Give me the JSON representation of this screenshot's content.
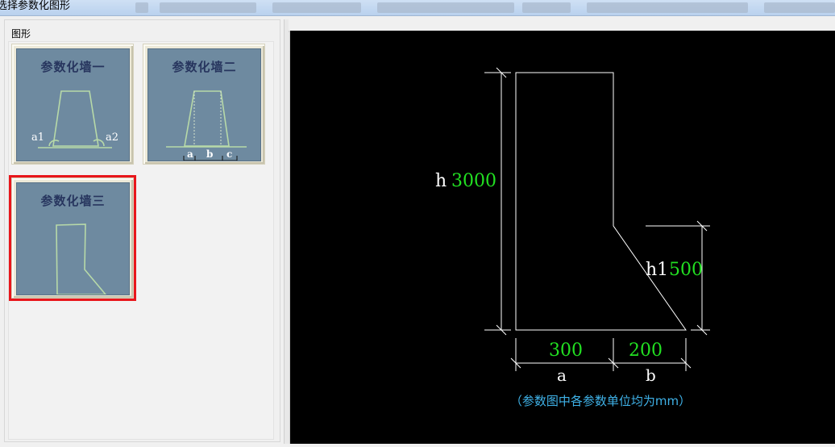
{
  "window": {
    "title": "选择参数化图形"
  },
  "shapes_panel": {
    "group_label": "图形",
    "items": [
      {
        "title": "参数化墙一",
        "labels": [
          "a1",
          "a2"
        ],
        "selected": false
      },
      {
        "title": "参数化墙二",
        "labels": [
          "a",
          "b",
          "c"
        ],
        "selected": false
      },
      {
        "title": "参数化墙三",
        "labels": [],
        "selected": true
      }
    ]
  },
  "preview": {
    "params": {
      "h": {
        "name": "h",
        "value": "3000"
      },
      "h1": {
        "name": "h1",
        "value": "500"
      },
      "a": {
        "name": "a",
        "value": "300"
      },
      "b": {
        "name": "b",
        "value": "200"
      }
    },
    "note": "（参数图中各参数单位均为mm）",
    "colors": {
      "background": "#000000",
      "lines": "#ffffff",
      "value_text": "#22e022",
      "name_text": "#ffffff",
      "note_text": "#3fb2e8",
      "selection": "#e8161b"
    }
  }
}
